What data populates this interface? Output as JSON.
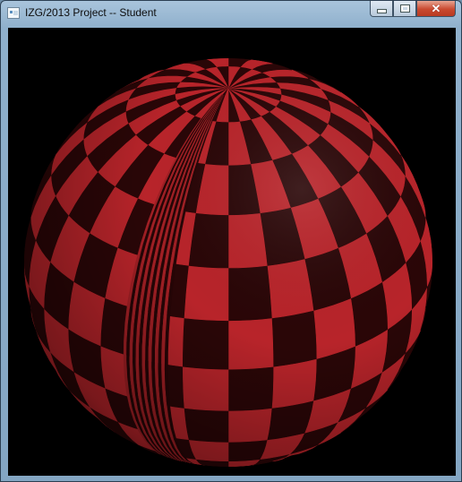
{
  "window": {
    "title": "IZG/2013 Project -- Student",
    "buttons": {
      "minimize_icon": "minimize-icon",
      "maximize_icon": "maximize-icon",
      "close_glyph": "✕"
    }
  },
  "scene": {
    "background_color": "#000000",
    "object": "checkered-sphere",
    "checker_color_light": "#b8242a",
    "checker_color_dark": "#2a0607"
  }
}
